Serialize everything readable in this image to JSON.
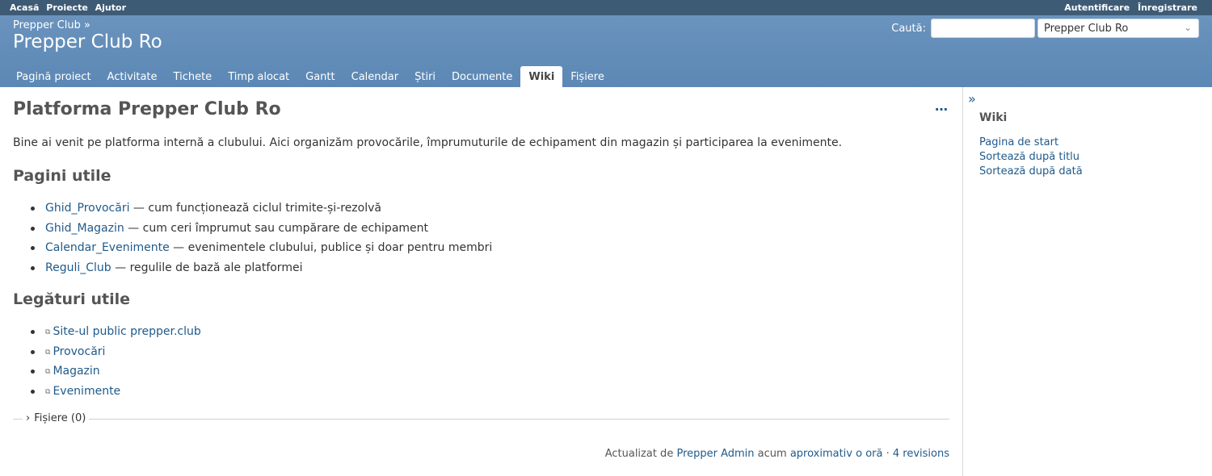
{
  "top_menu": {
    "left": [
      "Acasă",
      "Proiecte",
      "Ajutor"
    ],
    "right": [
      "Autentificare",
      "Înregistrare"
    ]
  },
  "header": {
    "breadcrumb": "Prepper Club »",
    "project_title": "Prepper Club Ro",
    "search_label": "Caută:",
    "search_value": "",
    "project_select": "Prepper Club Ro"
  },
  "tabs": [
    "Pagină proiect",
    "Activitate",
    "Tichete",
    "Timp alocat",
    "Gantt",
    "Calendar",
    "Știri",
    "Documente",
    "Wiki",
    "Fișiere"
  ],
  "selected_tab": "Wiki",
  "page": {
    "title": "Platforma Prepper Club Ro",
    "more_icon": "…",
    "intro": "Bine ai venit pe platforma internă a clubului. Aici organizăm provocările, împrumuturile de echipament din magazin și participarea la evenimente.",
    "pages_heading": "Pagini utile",
    "pages": [
      {
        "link": "Ghid_Provocări",
        "desc": " — cum funcționează ciclul trimite-și-rezolvă"
      },
      {
        "link": "Ghid_Magazin",
        "desc": " — cum ceri împrumut sau cumpărare de echipament"
      },
      {
        "link": "Calendar_Evenimente",
        "desc": " — evenimentele clubului, publice și doar pentru membri"
      },
      {
        "link": "Reguli_Club",
        "desc": " — regulile de bază ale platformei"
      }
    ],
    "links_heading": "Legături utile",
    "links": [
      "Site-ul public prepper.club",
      "Provocări",
      "Magazin",
      "Evenimente"
    ],
    "attachments": "Fișiere (0)",
    "footer": {
      "prefix": "Actualizat de ",
      "author": "Prepper Admin",
      "middle": " acum ",
      "time": "aproximativ o oră",
      "sep": " · ",
      "revisions": "4 revisions"
    }
  },
  "sidebar": {
    "toggle_icon": "»",
    "title": "Wiki",
    "links": [
      "Pagina de start",
      "Sortează după titlu",
      "Sortează după dată"
    ]
  }
}
